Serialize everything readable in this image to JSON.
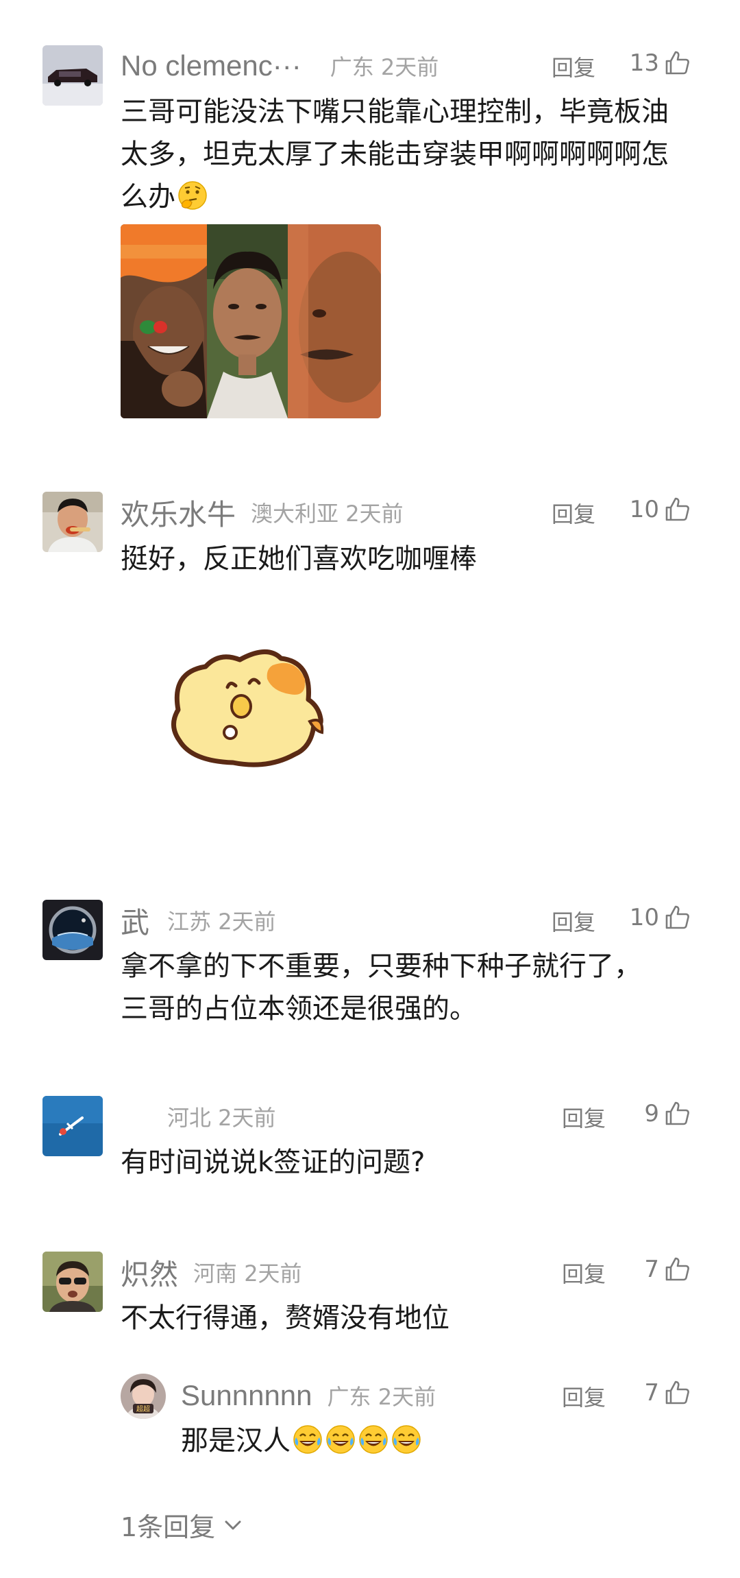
{
  "comments": [
    {
      "username": "No clemenc···",
      "meta": "广东  2天前",
      "reply": "回复",
      "likes": "13",
      "text": "三哥可能没法下嘴只能靠心理控制，毕竟板油太多，坦克太厚了未能击穿装甲啊啊啊啊啊怎么办"
    },
    {
      "username": "欢乐水牛",
      "meta": "澳大利亚  2天前",
      "reply": "回复",
      "likes": "10",
      "text": "挺好，反正她们喜欢吃咖喱棒"
    },
    {
      "username": "武",
      "meta": "江苏  2天前",
      "reply": "回复",
      "likes": "10",
      "text": "拿不拿的下不重要，只要种下种子就行了，三哥的占位本领还是很强的。"
    },
    {
      "username": "",
      "meta": "河北  2天前",
      "reply": "回复",
      "likes": "9",
      "text": "有时间说说k签证的问题?"
    },
    {
      "username": "炽然",
      "meta": "河南  2天前",
      "reply": "回复",
      "likes": "7",
      "text": "不太行得通，赘婿没有地位"
    }
  ],
  "sub_reply": {
    "username": "Sunnnnnn",
    "meta": "广东  2天前",
    "reply": "回复",
    "likes": "7",
    "text": "那是汉人"
  },
  "avatar_badge": "超超",
  "more_replies": "1条回复",
  "icons": {
    "like": "thumbs-up-outline-icon",
    "expand": "chevron-down-icon",
    "thinking_emoji": "thinking-face-emoji",
    "laugh_emoji": "tears-of-joy-emoji"
  },
  "colors": {
    "text": "#1a1a1a",
    "username": "#7b7b7b",
    "meta": "#a3a3a3"
  }
}
